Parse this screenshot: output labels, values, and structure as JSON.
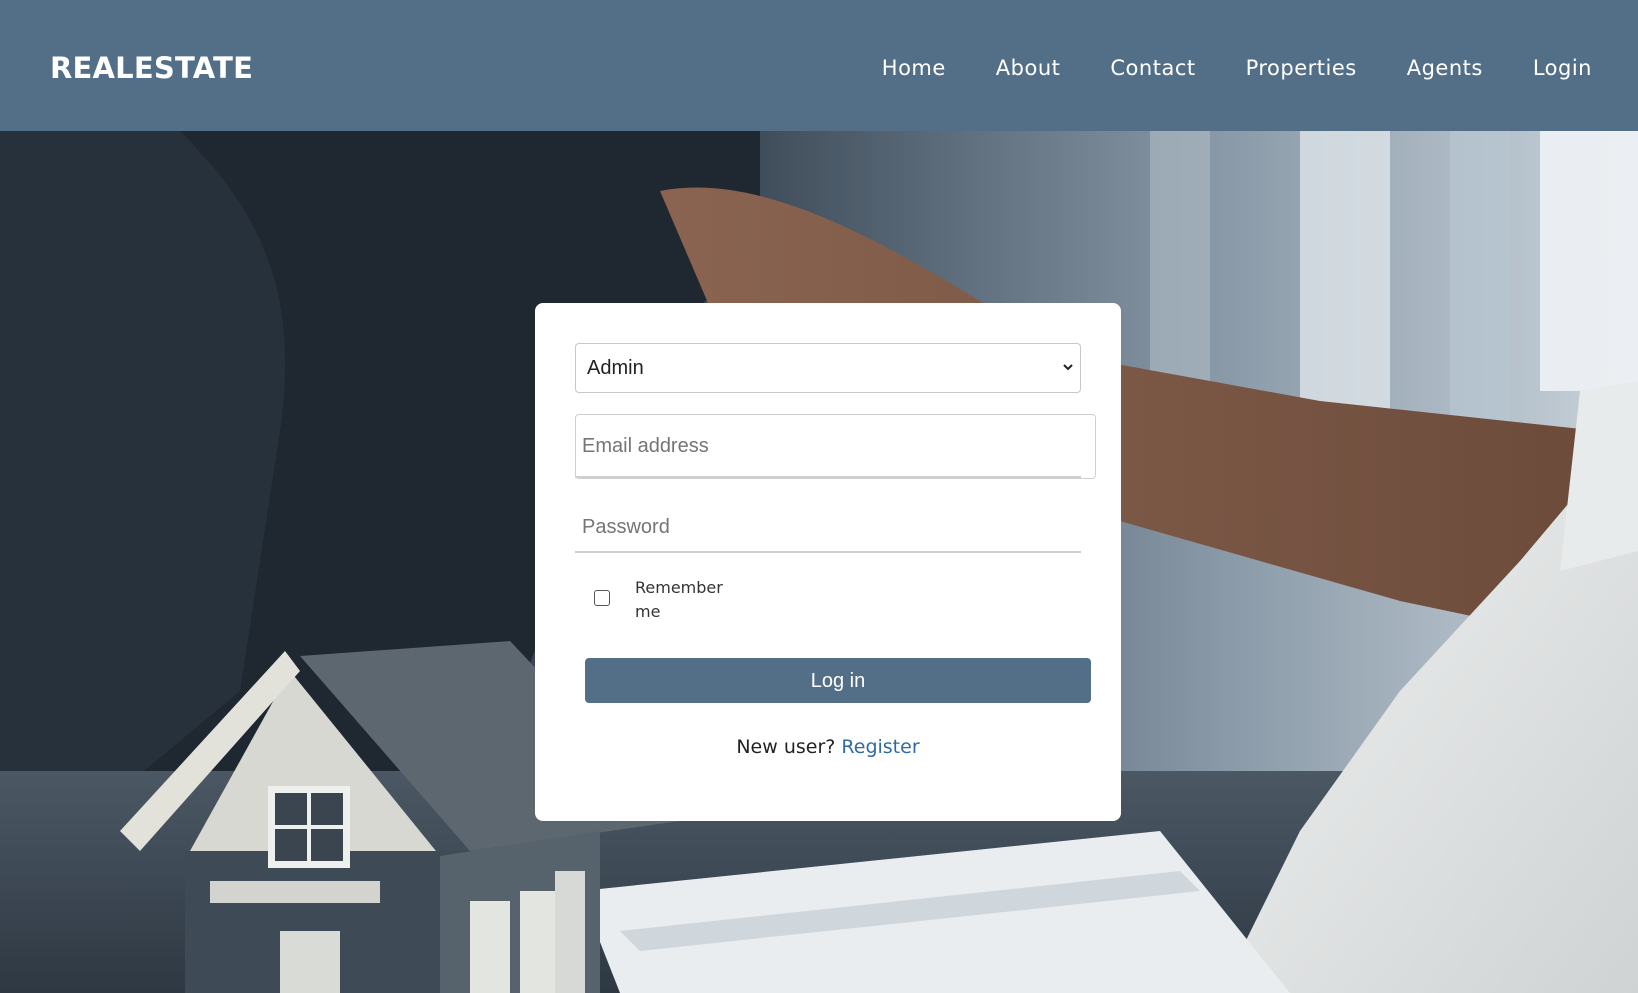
{
  "nav": {
    "brand": "REALESTATE",
    "links": [
      "Home",
      "About",
      "Contact",
      "Properties",
      "Agents",
      "Login"
    ]
  },
  "login_form": {
    "role_select": {
      "selected": "Admin",
      "icon": "chevron-down-icon"
    },
    "email": {
      "placeholder": "Email address"
    },
    "password": {
      "placeholder": "Password"
    },
    "remember_label": "Remember me",
    "submit_label": "Log in",
    "register_prompt": "New user?",
    "register_link": "Register"
  },
  "colors": {
    "navbar": "#536f88",
    "button": "#536f88",
    "link": "#2f6aa6"
  }
}
